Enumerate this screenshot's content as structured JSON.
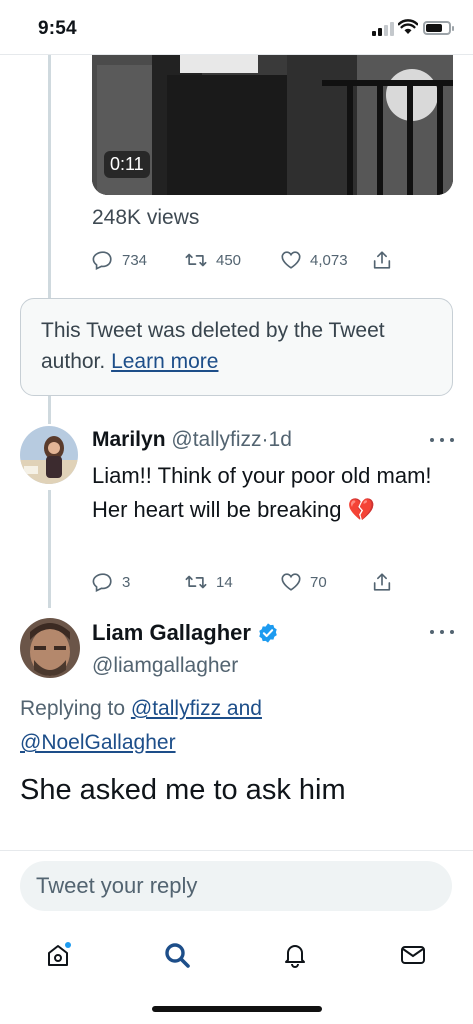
{
  "status_bar": {
    "time": "9:54"
  },
  "video_tweet": {
    "duration": "0:11",
    "views": "248K views",
    "stats": {
      "replies": "734",
      "retweets": "450",
      "likes": "4,073"
    }
  },
  "deleted_notice": {
    "text": "This Tweet was deleted by the Tweet author.",
    "link": "Learn more"
  },
  "reply_tweet": {
    "name": "Marilyn",
    "handle": "@tallyfizz",
    "separator": "·",
    "time": "1d",
    "text": "Liam!! Think of your poor old mam! Her heart will be breaking",
    "emoji": "💔",
    "stats": {
      "replies": "3",
      "retweets": "14",
      "likes": "70"
    }
  },
  "main_tweet": {
    "name": "Liam Gallagher",
    "verified": true,
    "handle": "@liamgallagher",
    "replying_prefix": "Replying to",
    "mention_1": "@tallyfizz and",
    "mention_2": "@NoelGallagher",
    "text": "She asked me to ask him"
  },
  "reply_composer": {
    "placeholder": "Tweet your reply"
  },
  "tabbar": {
    "tabs": [
      "home-icon",
      "search-icon",
      "notifications-icon",
      "messages-icon"
    ],
    "active": "search-icon",
    "accent": "#1d9bf0"
  },
  "colors": {
    "link": "#1d4e89",
    "muted": "#536471",
    "verified": "#1d9bf0"
  }
}
